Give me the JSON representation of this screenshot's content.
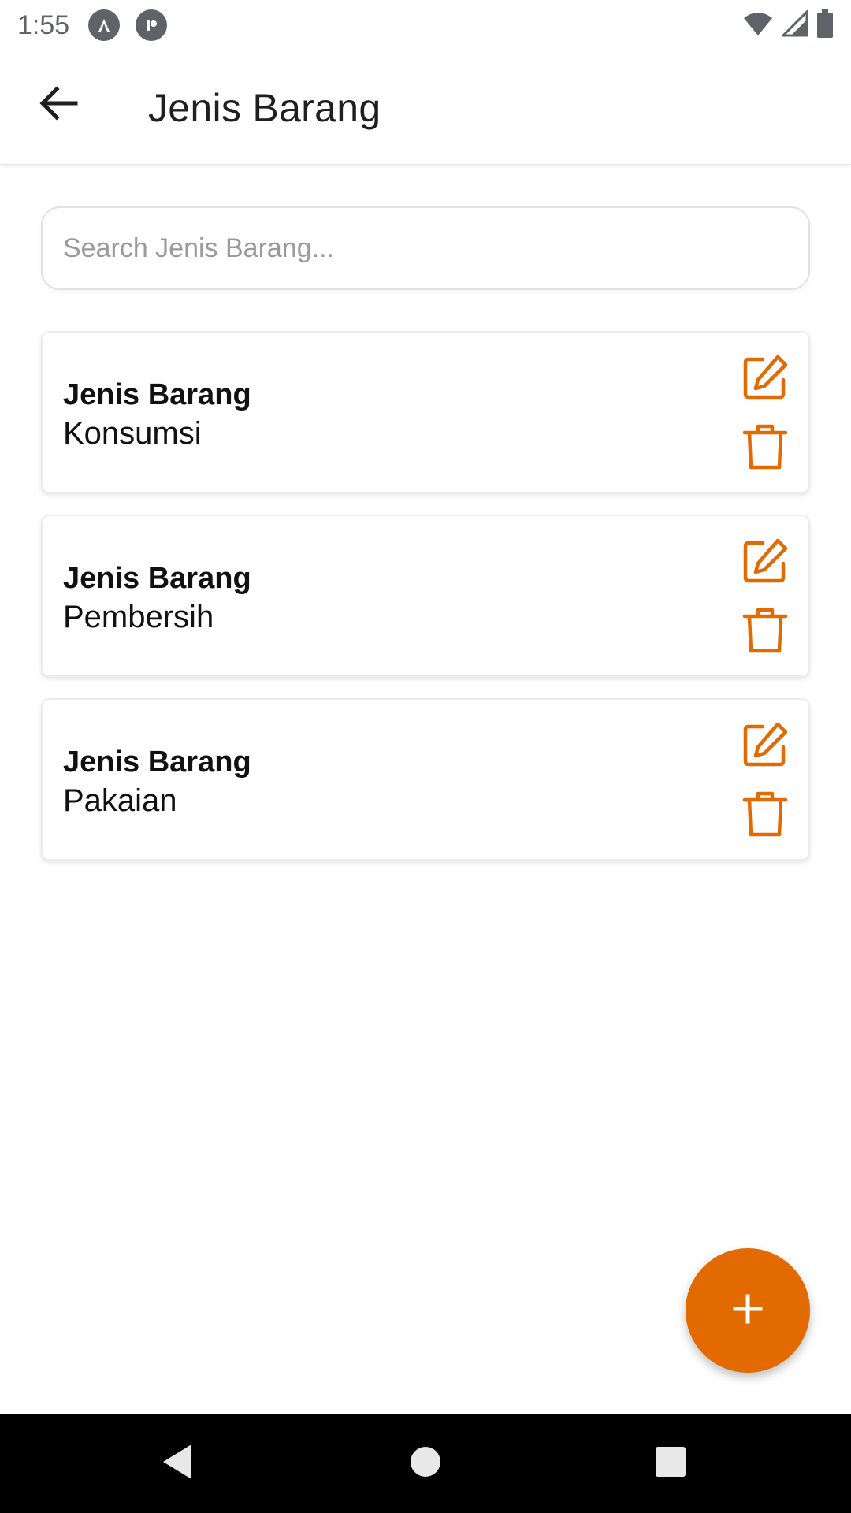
{
  "status_bar": {
    "time": "1:55",
    "icons": [
      "app-a-icon",
      "app-r-icon",
      "wifi-icon",
      "signal-icon",
      "battery-icon"
    ]
  },
  "app_bar": {
    "title": "Jenis Barang",
    "back_icon": "arrow-left-icon"
  },
  "search": {
    "placeholder": "Search Jenis Barang...",
    "value": ""
  },
  "items": [
    {
      "heading": "Jenis Barang",
      "value": "Konsumsi"
    },
    {
      "heading": "Jenis Barang",
      "value": "Pembersih"
    },
    {
      "heading": "Jenis Barang",
      "value": "Pakaian"
    }
  ],
  "fab": {
    "icon": "plus-icon",
    "label": "+"
  },
  "nav_bar": {
    "icons": [
      "nav-back-icon",
      "nav-home-icon",
      "nav-recents-icon"
    ]
  },
  "colors": {
    "accent": "#e36a00",
    "text": "#111111",
    "status_text": "#5f6368",
    "nav_background": "#000000"
  }
}
